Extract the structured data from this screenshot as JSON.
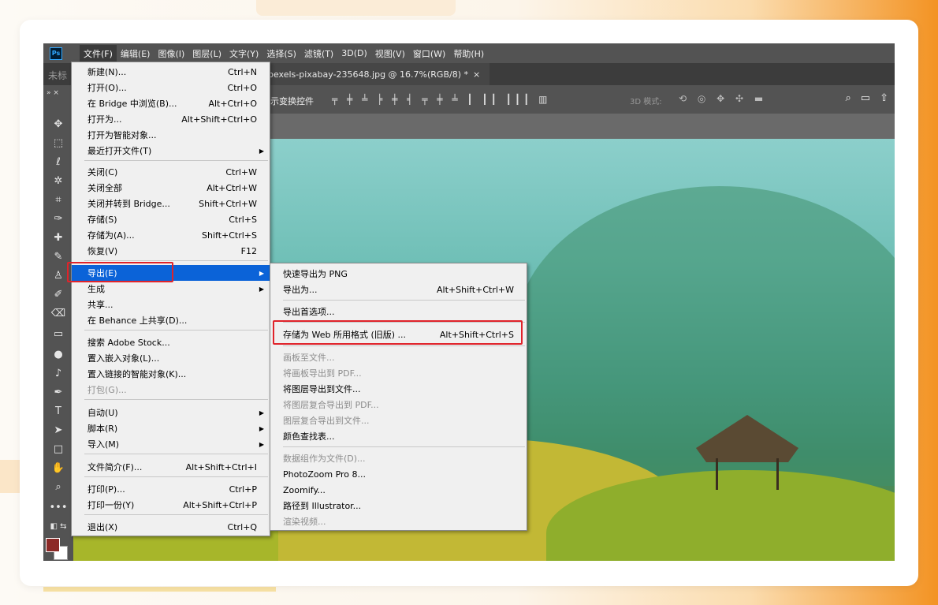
{
  "menubar": {
    "logo": "Ps",
    "items": [
      "文件(F)",
      "编辑(E)",
      "图像(I)",
      "图层(L)",
      "文字(Y)",
      "选择(S)",
      "滤镜(T)",
      "3D(D)",
      "视图(V)",
      "窗口(W)",
      "帮助(H)"
    ]
  },
  "tabs": {
    "doc_title": "未标",
    "active_tab": "pexels-pixabay-235648.jpg @ 16.7%(RGB/8) *",
    "close": "×"
  },
  "options": {
    "transform_controls": "示变换控件",
    "align_icons": "╤ ╪ ╧  ╞ ╪ ╡  ╤ ╪ ╧  ┃ ┃┃ ┃┃┃  ▥",
    "mode_3d": "3D 模式:",
    "icons_3d": "⟲ ◎ ✥ ✣ ▬",
    "search_icon": "⌕",
    "frame_icon": "▭",
    "share_icon": "⇧"
  },
  "file_menu": [
    {
      "label": "新建(N)...",
      "shortcut": "Ctrl+N"
    },
    {
      "label": "打开(O)...",
      "shortcut": "Ctrl+O"
    },
    {
      "label": "在 Bridge 中浏览(B)...",
      "shortcut": "Alt+Ctrl+O"
    },
    {
      "label": "打开为...",
      "shortcut": "Alt+Shift+Ctrl+O"
    },
    {
      "label": "打开为智能对象...",
      "shortcut": ""
    },
    {
      "label": "最近打开文件(T)",
      "shortcut": ""
    },
    {
      "label": "关闭(C)",
      "shortcut": "Ctrl+W"
    },
    {
      "label": "关闭全部",
      "shortcut": "Alt+Ctrl+W"
    },
    {
      "label": "关闭并转到 Bridge...",
      "shortcut": "Shift+Ctrl+W"
    },
    {
      "label": "存储(S)",
      "shortcut": "Ctrl+S"
    },
    {
      "label": "存储为(A)...",
      "shortcut": "Shift+Ctrl+S"
    },
    {
      "label": "恢复(V)",
      "shortcut": "F12"
    },
    {
      "label": "导出(E)",
      "shortcut": ""
    },
    {
      "label": "生成",
      "shortcut": ""
    },
    {
      "label": "共享...",
      "shortcut": ""
    },
    {
      "label": "在 Behance 上共享(D)...",
      "shortcut": ""
    },
    {
      "label": "搜索 Adobe Stock...",
      "shortcut": ""
    },
    {
      "label": "置入嵌入对象(L)...",
      "shortcut": ""
    },
    {
      "label": "置入链接的智能对象(K)...",
      "shortcut": ""
    },
    {
      "label": "打包(G)...",
      "shortcut": ""
    },
    {
      "label": "自动(U)",
      "shortcut": ""
    },
    {
      "label": "脚本(R)",
      "shortcut": ""
    },
    {
      "label": "导入(M)",
      "shortcut": ""
    },
    {
      "label": "文件简介(F)...",
      "shortcut": "Alt+Shift+Ctrl+I"
    },
    {
      "label": "打印(P)...",
      "shortcut": "Ctrl+P"
    },
    {
      "label": "打印一份(Y)",
      "shortcut": "Alt+Shift+Ctrl+P"
    },
    {
      "label": "退出(X)",
      "shortcut": "Ctrl+Q"
    }
  ],
  "export_submenu": [
    {
      "label": "快速导出为 PNG",
      "shortcut": ""
    },
    {
      "label": "导出为...",
      "shortcut": "Alt+Shift+Ctrl+W"
    },
    {
      "label": "导出首选项...",
      "shortcut": ""
    },
    {
      "label": "存储为 Web 所用格式 (旧版) ...",
      "shortcut": "Alt+Shift+Ctrl+S"
    },
    {
      "label": "画板至文件...",
      "shortcut": ""
    },
    {
      "label": "将画板导出到 PDF...",
      "shortcut": ""
    },
    {
      "label": "将图层导出到文件...",
      "shortcut": ""
    },
    {
      "label": "将图层复合导出到 PDF...",
      "shortcut": ""
    },
    {
      "label": "图层复合导出到文件...",
      "shortcut": ""
    },
    {
      "label": "颜色查找表...",
      "shortcut": ""
    },
    {
      "label": "数据组作为文件(D)...",
      "shortcut": ""
    },
    {
      "label": "PhotoZoom Pro 8...",
      "shortcut": ""
    },
    {
      "label": "Zoomify...",
      "shortcut": ""
    },
    {
      "label": "路径到 Illustrator...",
      "shortcut": ""
    },
    {
      "label": "渲染视频...",
      "shortcut": ""
    }
  ],
  "colors": {
    "foreground": "#8c2a27",
    "background": "#ffffff",
    "highlight": "#0b63d8",
    "annotation_red": "#e0232a"
  }
}
